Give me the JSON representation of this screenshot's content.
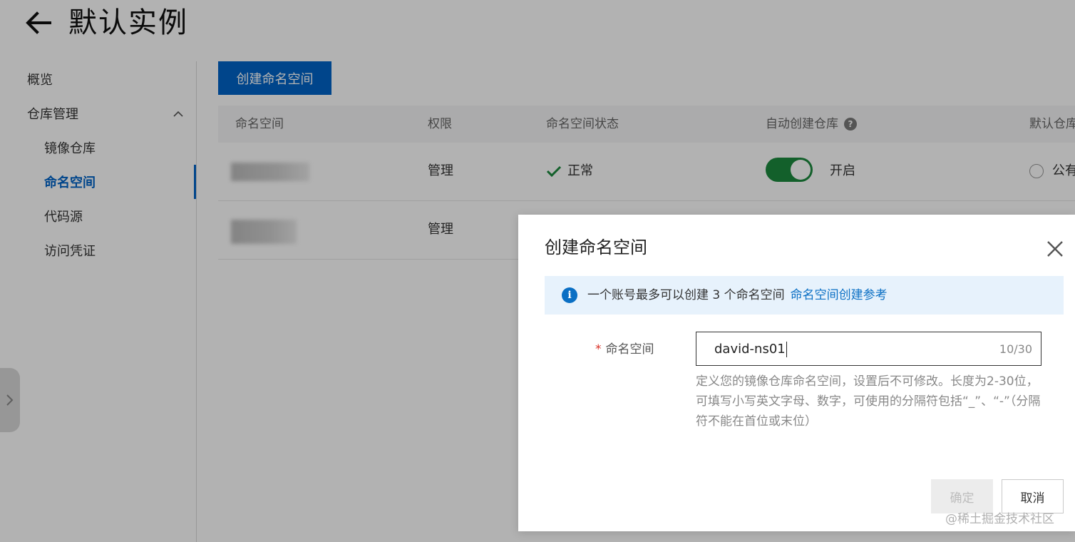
{
  "header": {
    "title": "默认实例"
  },
  "sidebar": {
    "items": [
      {
        "label": "概览"
      },
      {
        "label": "仓库管理"
      },
      {
        "label": "镜像仓库"
      },
      {
        "label": "命名空间"
      },
      {
        "label": "代码源"
      },
      {
        "label": "访问凭证"
      }
    ],
    "active": "命名空间"
  },
  "main": {
    "create_button": "创建命名空间",
    "columns": [
      "命名空间",
      "权限",
      "命名空间状态",
      "自动创建仓库",
      "默认仓库"
    ],
    "rows": [
      {
        "namespace": "",
        "permission": "管理",
        "status": "正常",
        "auto_create": "开启",
        "auto_create_on": true,
        "default_repo": "公有"
      },
      {
        "namespace": "",
        "permission": "管理"
      }
    ]
  },
  "dialog": {
    "title": "创建命名空间",
    "info": {
      "text": "一个账号最多可以创建 3 个命名空间",
      "link": "命名空间创建参考"
    },
    "field": {
      "label": "命名空间",
      "required_mark": "*",
      "value": "david-ns01",
      "counter": "10/30",
      "help": "定义您的镜像仓库命名空间，设置后不可修改。长度为2-30位，可填写小写英文字母、数字，可使用的分隔符包括“_”、“-”（分隔符不能在首位或末位）"
    },
    "ok_button": "确定",
    "cancel_button": "取消"
  },
  "watermark": "@稀土掘金技术社区",
  "colors": {
    "primary": "#0064c8",
    "toggle_on": "#1c8a3e",
    "info_bg": "#e7f2fc",
    "required": "#d93026"
  },
  "icons": [
    "back-arrow-icon",
    "chevron-up-icon",
    "chevron-right-icon",
    "help-icon",
    "check-icon",
    "info-icon",
    "close-icon"
  ]
}
